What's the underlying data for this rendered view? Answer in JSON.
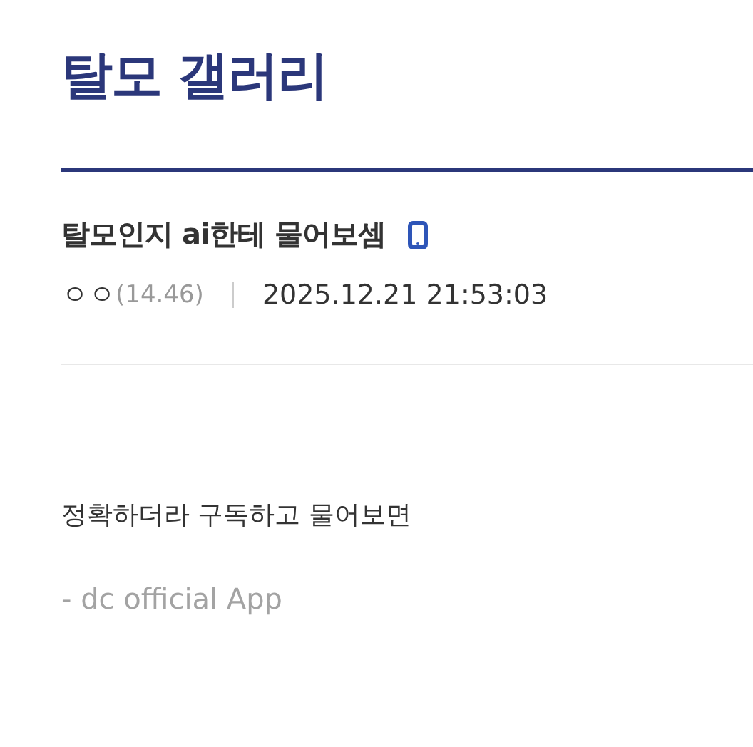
{
  "gallery_title": "탈모 갤러리",
  "post": {
    "title": "탈모인지 ai한테 물어보셈",
    "mobile": true,
    "author": "ㅇㅇ",
    "author_ip": "(14.46)",
    "date": "2025.12.21 21:53:03"
  },
  "body": [
    "정확하더라 구독하고 물어보면"
  ],
  "signature": "- dc official App"
}
